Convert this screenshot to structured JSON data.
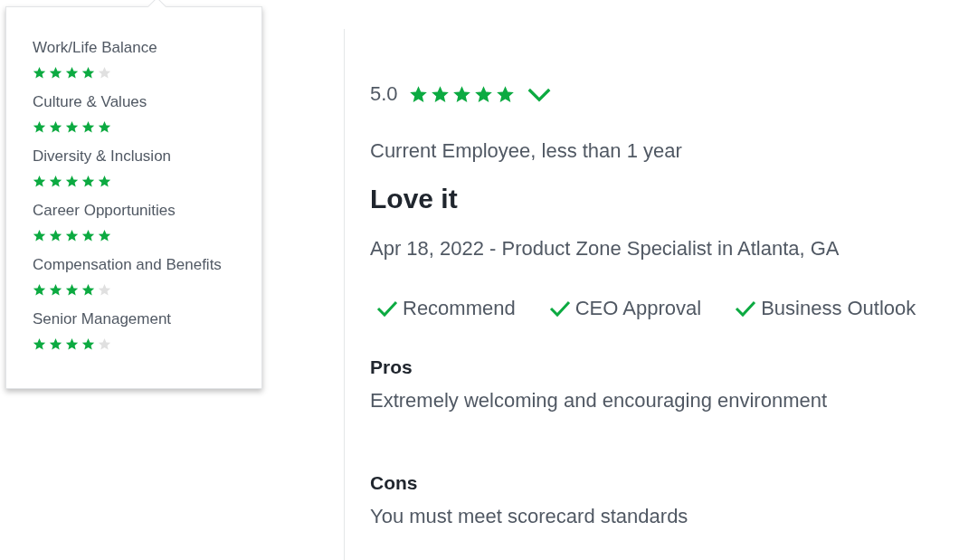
{
  "ratings_popup": {
    "items": [
      {
        "label": "Work/Life Balance",
        "stars": 4
      },
      {
        "label": "Culture & Values",
        "stars": 5
      },
      {
        "label": "Diversity & Inclusion",
        "stars": 5
      },
      {
        "label": "Career Opportunities",
        "stars": 5
      },
      {
        "label": "Compensation and Benefits",
        "stars": 4
      },
      {
        "label": "Senior Management",
        "stars": 4
      }
    ]
  },
  "review": {
    "rating": "5.0",
    "stars": 5,
    "expanded": false,
    "employee_status": "Current Employee, less than 1 year",
    "title": "Love it",
    "meta": "Apr 18, 2022 - Product Zone Specialist in Atlanta, GA",
    "indicators": [
      {
        "label": "Recommend",
        "checked": true
      },
      {
        "label": "CEO Approval",
        "checked": true
      },
      {
        "label": "Business Outlook",
        "checked": true
      }
    ],
    "sections": [
      {
        "heading": "Pros",
        "text": "Extremely welcoming and encouraging environment"
      },
      {
        "heading": "Cons",
        "text": "You must meet scorecard standards"
      }
    ]
  }
}
